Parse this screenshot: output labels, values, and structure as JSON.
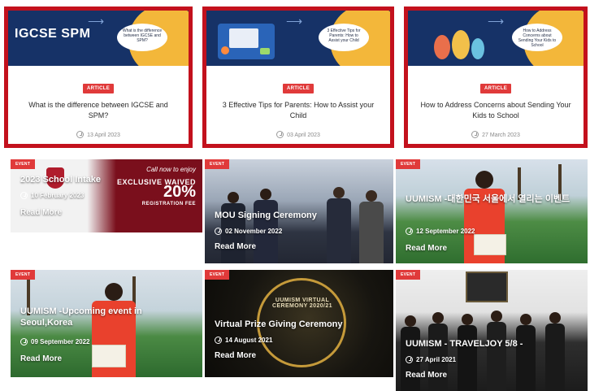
{
  "articles": [
    {
      "banner_logo": "IGCSE SPM",
      "banner_caption": "What is the difference between IGCSE and SPM?",
      "badge": "ARTICLE",
      "title": "What is the difference between IGCSE and SPM?",
      "date": "13 April 2023"
    },
    {
      "banner_logo": "",
      "banner_caption": "3 Effective Tips for Parents: How to Assist your Child",
      "badge": "ARTICLE",
      "title": "3 Effective Tips for Parents: How to Assist your Child",
      "date": "03 April 2023"
    },
    {
      "banner_logo": "",
      "banner_caption": "How to Address Concerns about Sending Your Kids to School",
      "badge": "ARTICLE",
      "title": "How to Address Concerns about Sending Your Kids to School",
      "date": "27 March 2023"
    }
  ],
  "events": [
    {
      "badge": "EVENT",
      "title": "2023 School Intake",
      "date": "10 February 2023",
      "more": "Read More",
      "promo": {
        "line1": "Call now to enjoy",
        "line2": "EXCLUSIVE WAIVED",
        "line3": "20%",
        "line4": "REGISTRATION FEE"
      }
    },
    {
      "badge": "EVENT",
      "title": "MOU Signing Ceremony",
      "date": "02 November 2022",
      "more": "Read More"
    },
    {
      "badge": "EVENT",
      "title": "UUMISM -대한민국 서울에서 열리는 이벤트",
      "date": "12 September 2022",
      "more": "Read More"
    },
    {
      "badge": "EVENT",
      "title": "UUMISM -Upcoming event in Seoul,Korea",
      "date": "09 September 2022",
      "more": "Read More"
    },
    {
      "badge": "EVENT",
      "title": "Virtual Prize Giving Ceremony",
      "date": "14 August 2021",
      "more": "Read More",
      "ring_text": "UUMISM VIRTUAL CEREMONY 2020/21"
    },
    {
      "badge": "EVENT",
      "title": "UUMISM - TRAVELJOY 5/8 -",
      "date": "27 April 2021",
      "more": "Read More"
    }
  ],
  "colors": {
    "card_border": "#c3111d",
    "badge": "#e03a3a",
    "banner_navy": "#163267",
    "banner_yellow": "#f3b73a"
  }
}
